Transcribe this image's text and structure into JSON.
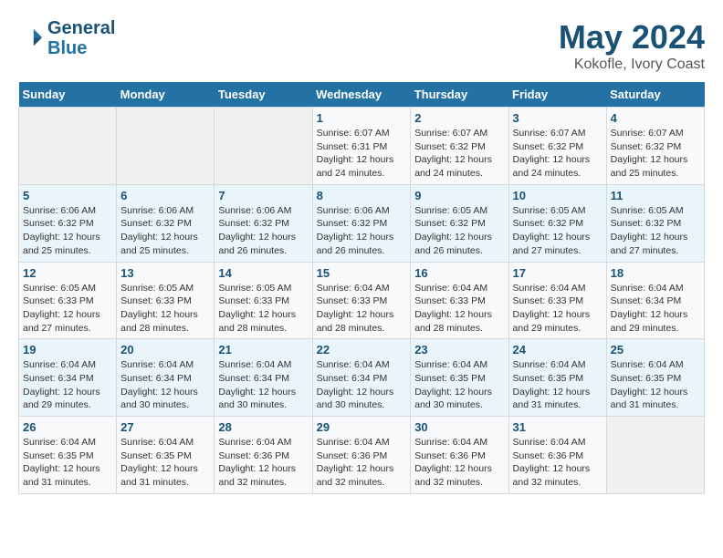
{
  "header": {
    "logo_line1": "General",
    "logo_line2": "Blue",
    "month_title": "May 2024",
    "location": "Kokofle, Ivory Coast"
  },
  "days_of_week": [
    "Sunday",
    "Monday",
    "Tuesday",
    "Wednesday",
    "Thursday",
    "Friday",
    "Saturday"
  ],
  "weeks": [
    [
      {
        "day": "",
        "info": ""
      },
      {
        "day": "",
        "info": ""
      },
      {
        "day": "",
        "info": ""
      },
      {
        "day": "1",
        "info": "Sunrise: 6:07 AM\nSunset: 6:31 PM\nDaylight: 12 hours and 24 minutes."
      },
      {
        "day": "2",
        "info": "Sunrise: 6:07 AM\nSunset: 6:32 PM\nDaylight: 12 hours and 24 minutes."
      },
      {
        "day": "3",
        "info": "Sunrise: 6:07 AM\nSunset: 6:32 PM\nDaylight: 12 hours and 24 minutes."
      },
      {
        "day": "4",
        "info": "Sunrise: 6:07 AM\nSunset: 6:32 PM\nDaylight: 12 hours and 25 minutes."
      }
    ],
    [
      {
        "day": "5",
        "info": "Sunrise: 6:06 AM\nSunset: 6:32 PM\nDaylight: 12 hours and 25 minutes."
      },
      {
        "day": "6",
        "info": "Sunrise: 6:06 AM\nSunset: 6:32 PM\nDaylight: 12 hours and 25 minutes."
      },
      {
        "day": "7",
        "info": "Sunrise: 6:06 AM\nSunset: 6:32 PM\nDaylight: 12 hours and 26 minutes."
      },
      {
        "day": "8",
        "info": "Sunrise: 6:06 AM\nSunset: 6:32 PM\nDaylight: 12 hours and 26 minutes."
      },
      {
        "day": "9",
        "info": "Sunrise: 6:05 AM\nSunset: 6:32 PM\nDaylight: 12 hours and 26 minutes."
      },
      {
        "day": "10",
        "info": "Sunrise: 6:05 AM\nSunset: 6:32 PM\nDaylight: 12 hours and 27 minutes."
      },
      {
        "day": "11",
        "info": "Sunrise: 6:05 AM\nSunset: 6:32 PM\nDaylight: 12 hours and 27 minutes."
      }
    ],
    [
      {
        "day": "12",
        "info": "Sunrise: 6:05 AM\nSunset: 6:33 PM\nDaylight: 12 hours and 27 minutes."
      },
      {
        "day": "13",
        "info": "Sunrise: 6:05 AM\nSunset: 6:33 PM\nDaylight: 12 hours and 28 minutes."
      },
      {
        "day": "14",
        "info": "Sunrise: 6:05 AM\nSunset: 6:33 PM\nDaylight: 12 hours and 28 minutes."
      },
      {
        "day": "15",
        "info": "Sunrise: 6:04 AM\nSunset: 6:33 PM\nDaylight: 12 hours and 28 minutes."
      },
      {
        "day": "16",
        "info": "Sunrise: 6:04 AM\nSunset: 6:33 PM\nDaylight: 12 hours and 28 minutes."
      },
      {
        "day": "17",
        "info": "Sunrise: 6:04 AM\nSunset: 6:33 PM\nDaylight: 12 hours and 29 minutes."
      },
      {
        "day": "18",
        "info": "Sunrise: 6:04 AM\nSunset: 6:34 PM\nDaylight: 12 hours and 29 minutes."
      }
    ],
    [
      {
        "day": "19",
        "info": "Sunrise: 6:04 AM\nSunset: 6:34 PM\nDaylight: 12 hours and 29 minutes."
      },
      {
        "day": "20",
        "info": "Sunrise: 6:04 AM\nSunset: 6:34 PM\nDaylight: 12 hours and 30 minutes."
      },
      {
        "day": "21",
        "info": "Sunrise: 6:04 AM\nSunset: 6:34 PM\nDaylight: 12 hours and 30 minutes."
      },
      {
        "day": "22",
        "info": "Sunrise: 6:04 AM\nSunset: 6:34 PM\nDaylight: 12 hours and 30 minutes."
      },
      {
        "day": "23",
        "info": "Sunrise: 6:04 AM\nSunset: 6:35 PM\nDaylight: 12 hours and 30 minutes."
      },
      {
        "day": "24",
        "info": "Sunrise: 6:04 AM\nSunset: 6:35 PM\nDaylight: 12 hours and 31 minutes."
      },
      {
        "day": "25",
        "info": "Sunrise: 6:04 AM\nSunset: 6:35 PM\nDaylight: 12 hours and 31 minutes."
      }
    ],
    [
      {
        "day": "26",
        "info": "Sunrise: 6:04 AM\nSunset: 6:35 PM\nDaylight: 12 hours and 31 minutes."
      },
      {
        "day": "27",
        "info": "Sunrise: 6:04 AM\nSunset: 6:35 PM\nDaylight: 12 hours and 31 minutes."
      },
      {
        "day": "28",
        "info": "Sunrise: 6:04 AM\nSunset: 6:36 PM\nDaylight: 12 hours and 32 minutes."
      },
      {
        "day": "29",
        "info": "Sunrise: 6:04 AM\nSunset: 6:36 PM\nDaylight: 12 hours and 32 minutes."
      },
      {
        "day": "30",
        "info": "Sunrise: 6:04 AM\nSunset: 6:36 PM\nDaylight: 12 hours and 32 minutes."
      },
      {
        "day": "31",
        "info": "Sunrise: 6:04 AM\nSunset: 6:36 PM\nDaylight: 12 hours and 32 minutes."
      },
      {
        "day": "",
        "info": ""
      }
    ]
  ]
}
